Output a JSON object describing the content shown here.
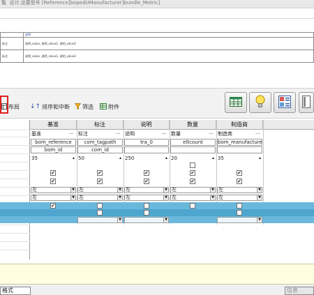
{
  "title": "覧 ­ 设计,设置型号 [Reference]bopedUManufacturer]bundle_Metric]",
  "mini_table": {
    "header": "说明",
    "row1_label": "标注",
    "row1_value": "说明_value, 说明_value1, 说明_value2",
    "row2_label": "标注",
    "row2_value": "说明_value, 说明_value1, 说明_value2"
  },
  "toolbar": {
    "layout_label": "布局",
    "sort_label": "排序和中断",
    "filter_label": "筛选",
    "attach_label": "附件"
  },
  "grid": {
    "columns": [
      "基准",
      "标注",
      "说明",
      "数量",
      "制造商"
    ],
    "titles": [
      "基准",
      "标注",
      "说明",
      "数量",
      "制造商"
    ],
    "props": [
      "bom_reference",
      "com_tagpath",
      "tra_0",
      "eltcount",
      "bom_manufacturer"
    ],
    "props2": [
      "bom_id",
      "com_id",
      "",
      "",
      ""
    ],
    "widths": [
      "35",
      "50",
      "250",
      "20",
      "35"
    ],
    "align1": [
      "左",
      "左",
      "左",
      "左",
      "左"
    ],
    "align2": [
      "左",
      "左",
      "左",
      "左",
      "左"
    ],
    "ellipsis": "···"
  },
  "status": {
    "tab_label": "格式",
    "tab2_label": "信息"
  },
  "colors": {
    "highlight": "#6ab8dc",
    "red_focus": "#e02020",
    "info_bg": "#fffee1"
  }
}
